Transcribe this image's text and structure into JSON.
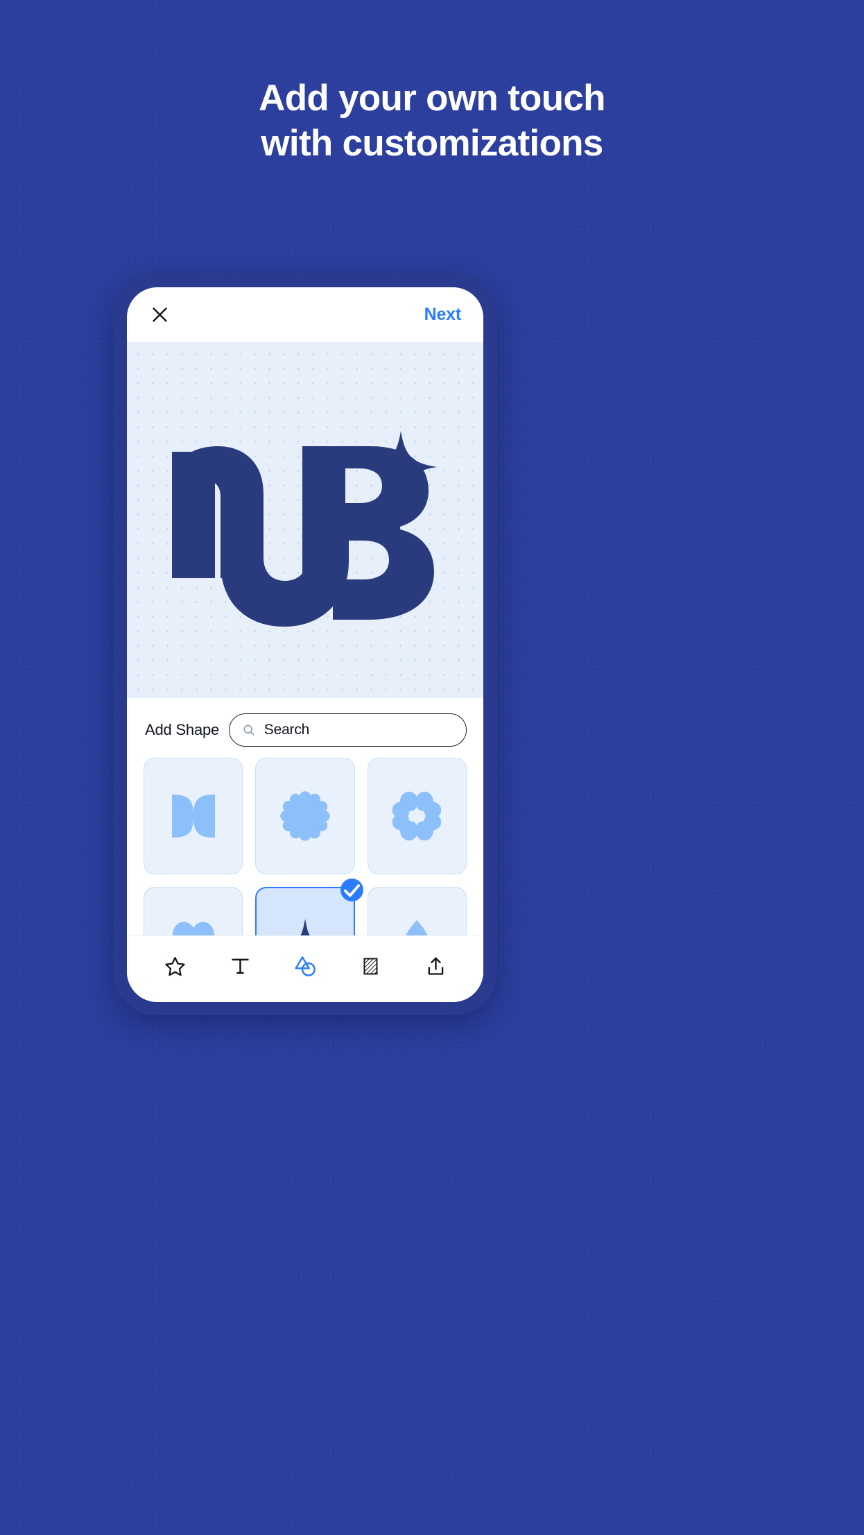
{
  "theme": {
    "background": "#2c3f9e",
    "phone_frame": "#2a3a8e",
    "accent_blue": "#2b7dff",
    "logo_navy": "#2a3b7d",
    "canvas_bg": "#e6effa",
    "shape_fill": "#8dc0fa",
    "card_bg": "#e8f1fc",
    "card_selected_bg": "#d5e5fb"
  },
  "headline": {
    "line1": "Add your own touch",
    "line2": "with customizations"
  },
  "app": {
    "topbar": {
      "close_label": "Close",
      "next_label": "Next"
    },
    "canvas": {
      "logo_text": "NB",
      "sparkle_label": "sparkle"
    },
    "panel": {
      "title": "Add Shape",
      "search": {
        "value": "",
        "placeholder": "Search"
      },
      "shapes": [
        {
          "id": "quatrefoil-inward",
          "name": "four-petal-inward",
          "selected": false
        },
        {
          "id": "cog-blob",
          "name": "twelve-lobe-blob",
          "selected": false
        },
        {
          "id": "flower-ring",
          "name": "eight-petal-ring",
          "selected": false
        },
        {
          "id": "clover-four",
          "name": "four-leaf-clover",
          "selected": false
        },
        {
          "id": "sparkle-star",
          "name": "four-point-star",
          "selected": true
        },
        {
          "id": "trefoil",
          "name": "three-leaf-trefoil",
          "selected": false
        },
        {
          "id": "row3-a",
          "name": "shape-partial-a",
          "selected": false
        },
        {
          "id": "row3-b",
          "name": "shape-partial-b",
          "selected": false
        },
        {
          "id": "row3-c",
          "name": "shape-partial-c",
          "selected": false
        }
      ],
      "selected_badge": "check"
    },
    "toolbar": [
      {
        "id": "stickers",
        "icon": "star-icon",
        "active": false
      },
      {
        "id": "text",
        "icon": "text-t-icon",
        "active": false
      },
      {
        "id": "shapes",
        "icon": "shapes-icon",
        "active": true
      },
      {
        "id": "texture",
        "icon": "hatch-icon",
        "active": false
      },
      {
        "id": "export",
        "icon": "upload-icon",
        "active": false
      }
    ]
  }
}
